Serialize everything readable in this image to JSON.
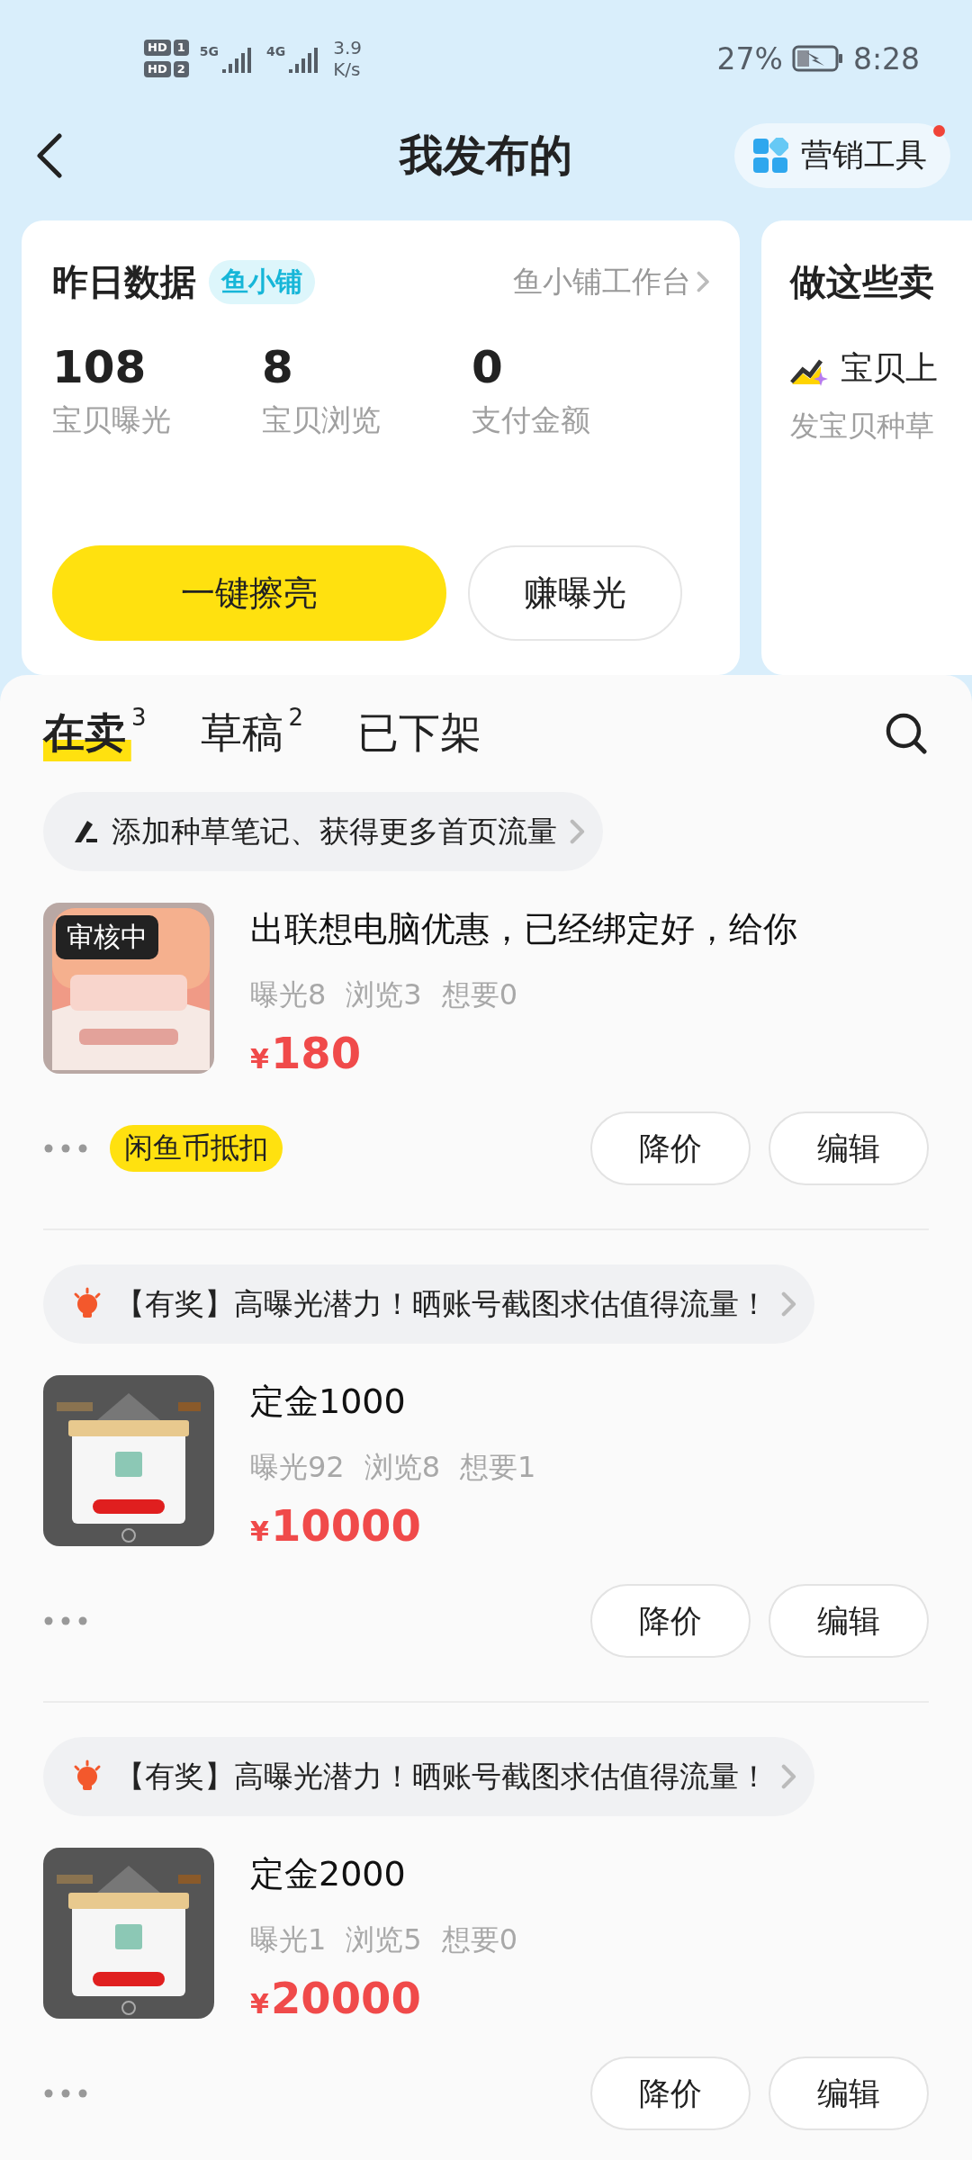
{
  "status_bar": {
    "sims": [
      {
        "label": "HD",
        "slot": "1"
      },
      {
        "label": "HD",
        "slot": "2"
      }
    ],
    "networks": [
      "5G",
      "4G"
    ],
    "speed_value": "3.9",
    "speed_unit": "K/s",
    "battery": "27%",
    "time": "8:28"
  },
  "header": {
    "title": "我发布的",
    "tool": {
      "label": "营销工具",
      "notification": true
    }
  },
  "stats_card": {
    "title": "昨日数据",
    "tag": "鱼小铺",
    "link": "鱼小铺工作台",
    "metrics": [
      {
        "value": "108",
        "label": "宝贝曝光"
      },
      {
        "value": "8",
        "label": "宝贝浏览"
      },
      {
        "value": "0",
        "label": "支付金额"
      }
    ],
    "buttons": [
      {
        "label": "一键擦亮",
        "kind": "primary"
      },
      {
        "label": "赚曝光",
        "kind": "outline"
      }
    ]
  },
  "tasks_card": {
    "title": "做这些卖",
    "item": "宝贝上",
    "description": "发宝贝种草"
  },
  "tabs": [
    {
      "label": "在卖",
      "count": "3",
      "selected": true
    },
    {
      "label": "草稿",
      "count": "2",
      "selected": false
    },
    {
      "label": "已下架",
      "selected": false
    }
  ],
  "listings": [
    {
      "tip": {
        "kind": "note",
        "text": "添加种草笔记、获得更多首页流量"
      },
      "badge": "审核中",
      "title": "出联想电脑优惠，已经绑定好，给你",
      "stats": [
        "曝光8",
        "浏览3",
        "想要0"
      ],
      "currency": "¥",
      "price": "180",
      "coin_tag": "闲鱼币抵扣",
      "actions": [
        "降价",
        "编辑"
      ]
    },
    {
      "tip": {
        "kind": "reward",
        "text": "【有奖】高曝光潜力！晒账号截图求估值得流量！"
      },
      "title": "定金1000",
      "stats": [
        "曝光92",
        "浏览8",
        "想要1"
      ],
      "currency": "¥",
      "price": "10000",
      "actions": [
        "降价",
        "编辑"
      ]
    },
    {
      "tip": {
        "kind": "reward",
        "text": "【有奖】高曝光潜力！晒账号截图求估值得流量！"
      },
      "title": "定金2000",
      "stats": [
        "曝光1",
        "浏览5",
        "想要0"
      ],
      "currency": "¥",
      "price": "20000",
      "actions": [
        "降价",
        "编辑"
      ]
    }
  ]
}
